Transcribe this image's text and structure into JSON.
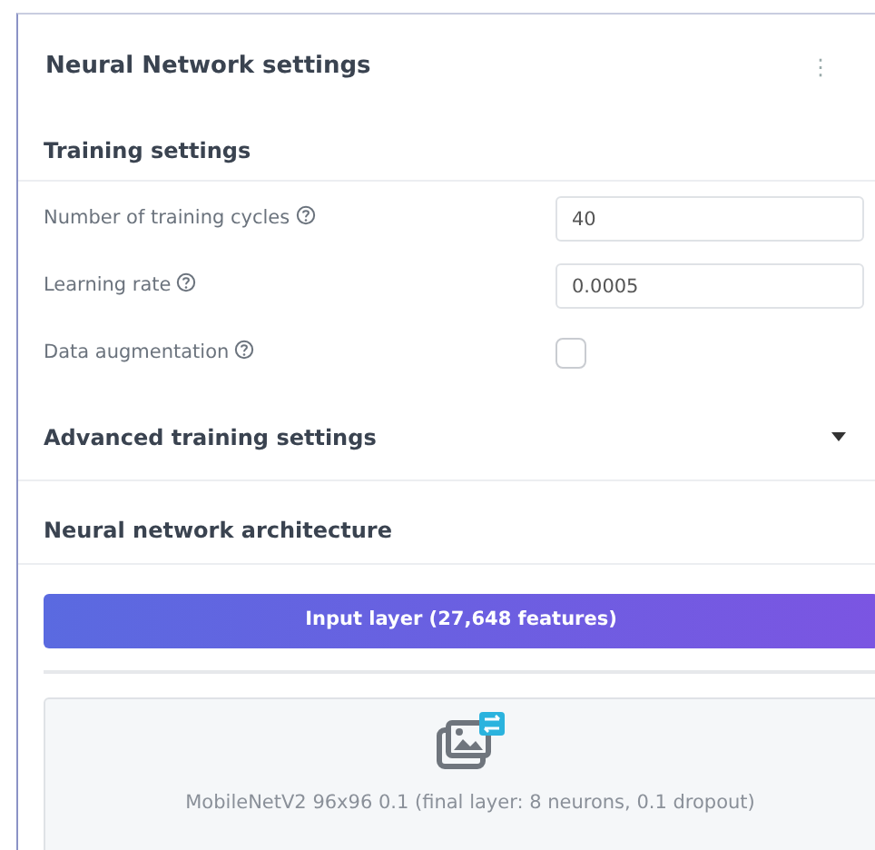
{
  "card": {
    "title": "Neural Network settings",
    "menu_icon": "⋮"
  },
  "training": {
    "title": "Training settings",
    "fields": [
      {
        "kind": "input",
        "label": "Number of training cycles",
        "value": "40"
      },
      {
        "kind": "input",
        "label": "Learning rate",
        "value": "0.0005"
      },
      {
        "kind": "checkbox",
        "label": "Data augmentation",
        "checked": false
      }
    ]
  },
  "advanced": {
    "title": "Advanced training settings",
    "expanded": false
  },
  "architecture": {
    "title": "Neural network architecture",
    "input_layer": "Input layer (27,648 features)",
    "model": "MobileNetV2 96x96 0.1 (final layer: 8 neurons, 0.1 dropout)"
  }
}
